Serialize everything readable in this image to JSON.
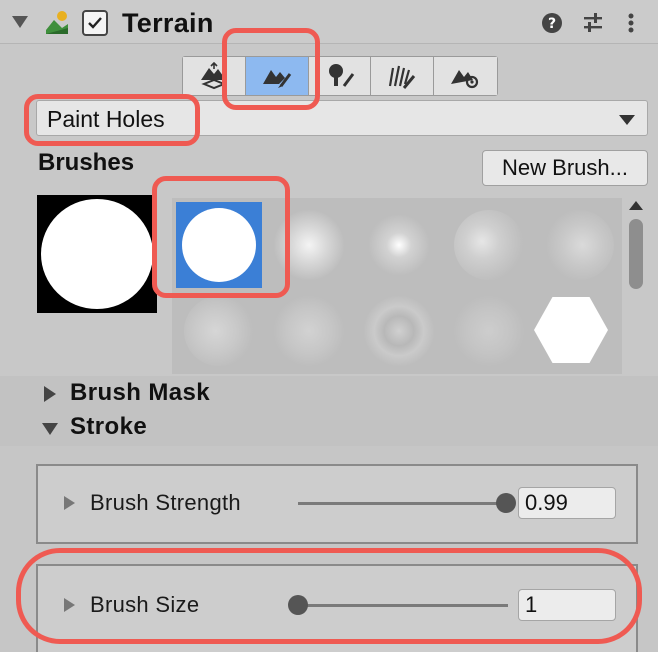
{
  "header": {
    "title": "Terrain",
    "enabled": true,
    "icons": [
      "foldout-arrow-icon",
      "terrain-icon",
      "checkbox-icon",
      "help-icon",
      "preset-sliders-icon",
      "more-vertical-icon"
    ]
  },
  "toolbar": {
    "tools": [
      {
        "name": "raise-lower-terrain",
        "active": false
      },
      {
        "name": "paint-terrain",
        "active": true
      },
      {
        "name": "paint-trees",
        "active": false
      },
      {
        "name": "paint-details",
        "active": false
      },
      {
        "name": "terrain-settings",
        "active": false
      }
    ]
  },
  "mode_dropdown": {
    "value": "Paint Holes"
  },
  "brushes": {
    "label": "Brushes",
    "new_brush_label": "New Brush...",
    "selected_index": 0
  },
  "sections": {
    "brush_mask": "Brush Mask",
    "stroke": "Stroke"
  },
  "stroke": {
    "brush_strength": {
      "label": "Brush Strength",
      "value": "0.99",
      "slider_fraction": 0.99
    },
    "brush_size": {
      "label": "Brush Size",
      "value": "1",
      "slider_fraction": 0.0
    }
  },
  "colors": {
    "accent_selected": "#3b7fd6",
    "active_tool": "#8db9f0",
    "highlight": "#ef5a52"
  }
}
